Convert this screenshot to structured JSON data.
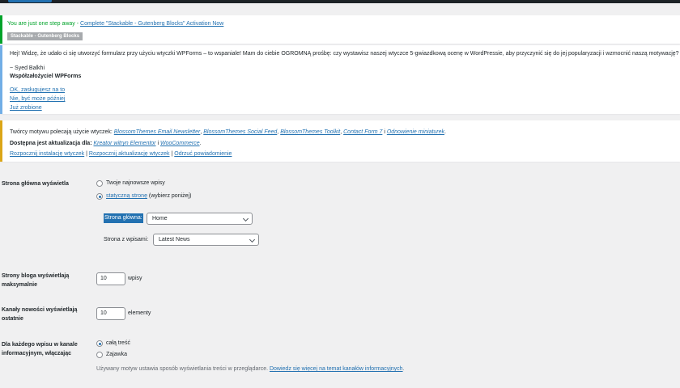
{
  "stackable_notice": {
    "message": "You are just one step away - ",
    "link": "Complete \"Stackable - Gutenberg Blocks\" Activation Now",
    "badge": "Stackable - Gutenberg Blocks"
  },
  "wpforms_notice": {
    "text": "Hej! Widzę, że udało ci się utworzyć formularz przy użyciu wtyczki WPForms – to wspaniale! Mam do ciebie OGROMNĄ prośbę: czy wystawisz naszej wtyczce 5-gwiazdkową ocenę w WordPressie, aby przyczynić się do jej popularyzacji i wzmocnić naszą motywację?",
    "author": "~ Syed Balkhi",
    "role": "Współzałożyciel WPForms",
    "links": [
      "OK, zasługujesz na to",
      "Nie, być może później",
      "Już zrobione"
    ]
  },
  "theme_notice": {
    "line1_prefix": "Twórcy motywu polecają użycie wtyczek: ",
    "plugins": [
      "BlossomThemes Email Newsletter",
      "BlossomThemes Social Feed",
      "BlossomThemes Toolkit",
      "Contact Form 7",
      "Odnowienie miniaturek"
    ],
    "line2_prefix": "Dostępna jest aktualizacja dla: ",
    "updates": [
      "Kreator witryn Elementor",
      "WooCommerce"
    ],
    "actions": [
      "Rozpocznij instalację wtyczek",
      "Rozpocznij aktualizację wtyczek",
      "Odrzuć powiadomienie"
    ]
  },
  "settings": {
    "homepage_display": {
      "label": "Strona główna wyświetla",
      "option_latest": "Twoje najnowsze wpisy",
      "option_static_link": "statyczną stronę",
      "option_static_suffix": " (wybierz poniżej)",
      "homepage_label": "Strona główna:",
      "homepage_value": "Home",
      "posts_page_label": "Strona z wpisami:",
      "posts_page_value": "Latest News"
    },
    "blog_pages": {
      "label": "Strony bloga wyświetlają maksymalnie",
      "value": "10",
      "unit": "wpisy"
    },
    "feeds": {
      "label": "Kanały nowości wyświetlają ostatnie",
      "value": "10",
      "unit": "elementy"
    },
    "feed_content": {
      "label": "Dla każdego wpisu w kanale informacyjnym, włączając",
      "option_full": "całą treść",
      "option_excerpt": "Zajawka",
      "desc_prefix": "Używany motyw ustawia sposób wyświetlania treści w przeglądarce. ",
      "desc_link": "Dowiedz się więcej na temat kanałów informacyjnych"
    }
  }
}
